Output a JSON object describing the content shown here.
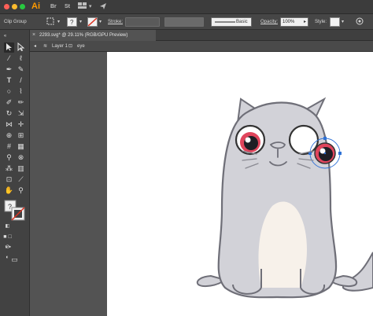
{
  "app": {
    "logo": "Ai"
  },
  "appbar": {
    "icons": [
      "bridge-icon",
      "stock-icon",
      "workspace-icon",
      "send-icon"
    ],
    "bridge_label": "Br",
    "stock_label": "St"
  },
  "control_bar": {
    "selection_label": "Clip Group",
    "stroke_label": "Stroke:",
    "brush_label": "Basic",
    "opacity_label": "Opacity:",
    "opacity_value": "100%",
    "style_label": "Style:"
  },
  "tab": {
    "title": "2293.svg* @ 29.11% (RGB/GPU Preview)"
  },
  "breadcrumb": {
    "layer": "Layer 1",
    "group": "eye"
  },
  "colors": {
    "accent": "#2f72d6",
    "cat_body": "#d2d2d8",
    "cat_outline": "#6f6f78",
    "belly": "#f7f1ea",
    "eye_red": "#e0455c"
  }
}
